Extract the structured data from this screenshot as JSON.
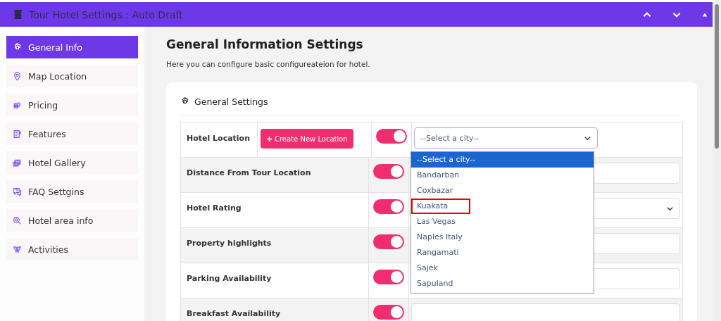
{
  "window": {
    "title": "Tour Hotel Settings : Auto Draft"
  },
  "sidebar": {
    "items": [
      {
        "label": "General Info",
        "selected": true
      },
      {
        "label": "Map Location",
        "selected": false
      },
      {
        "label": "Pricing",
        "selected": false
      },
      {
        "label": "Features",
        "selected": false
      },
      {
        "label": "Hotel Gallery",
        "selected": false
      },
      {
        "label": "FAQ Settgins",
        "selected": false
      },
      {
        "label": "Hotel area info",
        "selected": false
      },
      {
        "label": "Activities",
        "selected": false
      }
    ]
  },
  "page": {
    "title": "General Information Settings",
    "subtitle": "Here you can configure basic configureateion for hotel."
  },
  "card": {
    "title": "General Settings",
    "rows": [
      {
        "label": "Hotel Location",
        "kind": "location",
        "button": "Create New Location",
        "on": true,
        "value": "--Select a city--"
      },
      {
        "label": "Distance From Tour Location",
        "kind": "input",
        "on": true
      },
      {
        "label": "Hotel Rating",
        "kind": "select",
        "on": true
      },
      {
        "label": "Property highlights",
        "kind": "input",
        "on": true
      },
      {
        "label": "Parking Availability",
        "kind": "input",
        "on": true
      },
      {
        "label": "Breakfast Availability",
        "kind": "input",
        "on": true
      }
    ]
  },
  "dropdown": {
    "options": [
      {
        "label": "--Select a city--",
        "selected": true,
        "outlined": false
      },
      {
        "label": "Bandarban",
        "selected": false,
        "outlined": false
      },
      {
        "label": "Coxbazar",
        "selected": false,
        "outlined": false
      },
      {
        "label": "Kuakata",
        "selected": false,
        "outlined": true
      },
      {
        "label": "Las Vegas",
        "selected": false,
        "outlined": false
      },
      {
        "label": "Naples Italy",
        "selected": false,
        "outlined": false
      },
      {
        "label": "Rangamati",
        "selected": false,
        "outlined": false
      },
      {
        "label": "Sajek",
        "selected": false,
        "outlined": false
      },
      {
        "label": "Sapuland",
        "selected": false,
        "outlined": false
      }
    ]
  }
}
